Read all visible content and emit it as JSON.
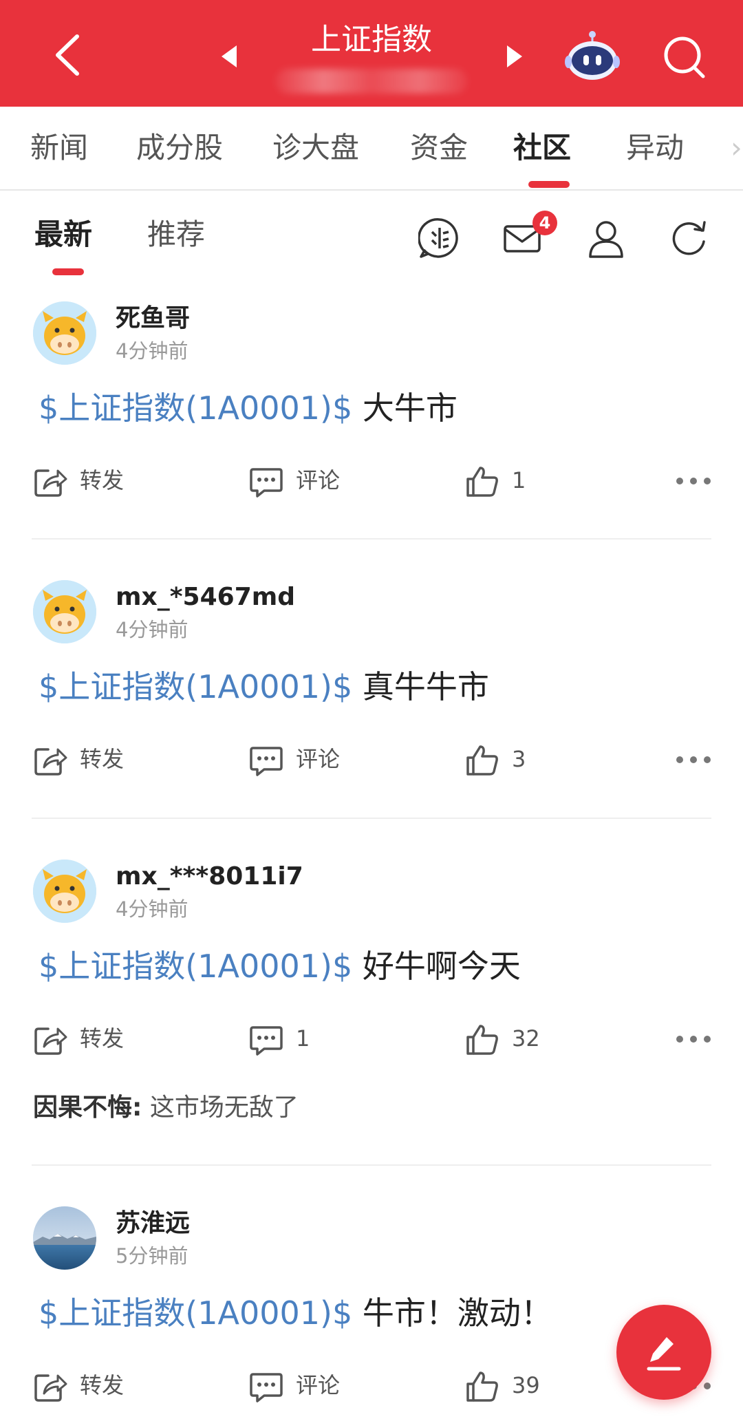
{
  "header": {
    "title": "上证指数",
    "icons": [
      "back-arrow-icon",
      "prev-triangle-icon",
      "next-triangle-icon",
      "robot-assistant-icon",
      "search-icon"
    ],
    "accent_color": "#e8323c"
  },
  "tabs": [
    "新闻",
    "成分股",
    "诊大盘",
    "资金",
    "社区",
    "异动"
  ],
  "active_tab": "社区",
  "subtabs": [
    "最新",
    "推荐"
  ],
  "active_subtab": "最新",
  "toolbar": {
    "icons": [
      "community-logo-icon",
      "mail-icon",
      "user-icon",
      "refresh-icon"
    ],
    "mail_badge": "4"
  },
  "actions_labels": {
    "repost": "转发",
    "comment": "评论"
  },
  "posts": [
    {
      "username": "死鱼哥",
      "time": "4分钟前",
      "avatar": "cow-avatar",
      "stock_tag": "$上证指数(1A0001)$",
      "text": " 大牛市",
      "repost": "转发",
      "comment": "评论",
      "likes": "1"
    },
    {
      "username": "mx_*5467md",
      "time": "4分钟前",
      "avatar": "cow-avatar",
      "stock_tag": "$上证指数(1A0001)$",
      "text": " 真牛牛市",
      "repost": "转发",
      "comment": "评论",
      "likes": "3"
    },
    {
      "username": "mx_***8011i7",
      "time": "4分钟前",
      "avatar": "cow-avatar",
      "stock_tag": "$上证指数(1A0001)$",
      "text": " 好牛啊今天",
      "repost": "转发",
      "comment": "1",
      "likes": "32",
      "top_comment": {
        "author": "因果不悔:",
        "text": " 这市场无敌了"
      }
    },
    {
      "username": "苏淮远",
      "time": "5分钟前",
      "avatar": "landscape-avatar",
      "stock_tag": "$上证指数(1A0001)$",
      "text": " 牛市！激动！",
      "repost": "转发",
      "comment": "评论",
      "likes": "39"
    }
  ],
  "fab": {
    "icon": "pencil-edit-icon"
  }
}
